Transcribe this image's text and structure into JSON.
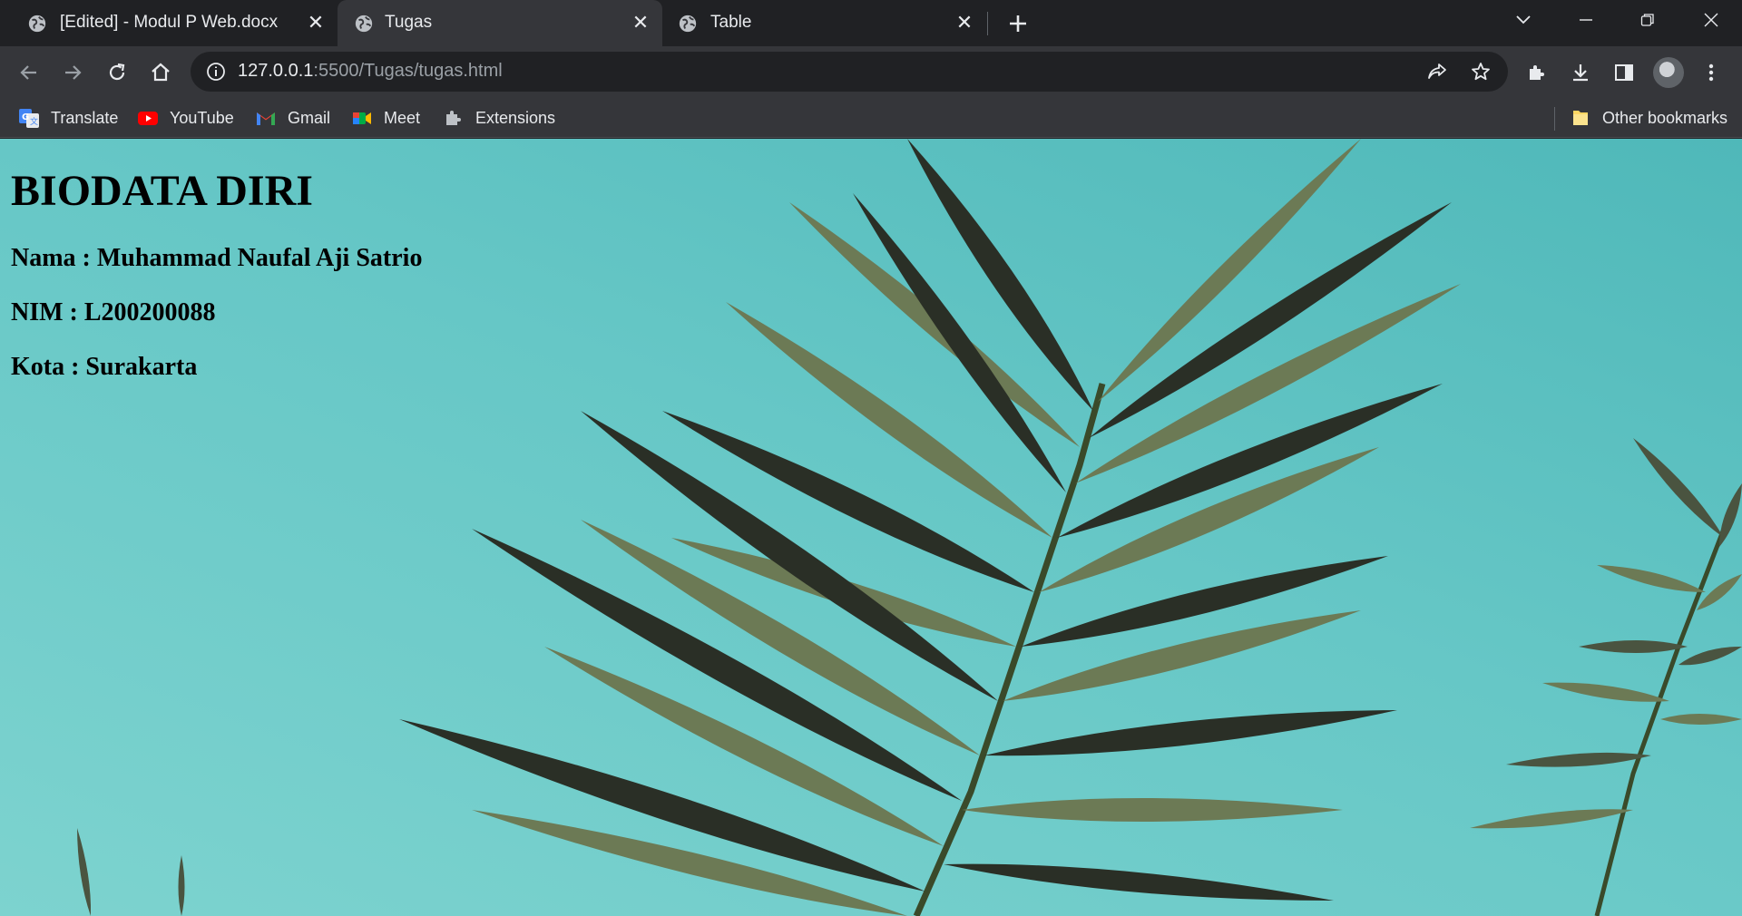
{
  "tabs": [
    {
      "title": "[Edited] - Modul P Web.docx",
      "active": false
    },
    {
      "title": "Tugas",
      "active": true
    },
    {
      "title": "Table",
      "active": false
    }
  ],
  "toolbar": {
    "url_host": "127.0.0.1",
    "url_rest": ":5500/Tugas/tugas.html"
  },
  "bookmarks": {
    "items": [
      {
        "label": "Translate",
        "icon": "google-translate-icon"
      },
      {
        "label": "YouTube",
        "icon": "youtube-icon"
      },
      {
        "label": "Gmail",
        "icon": "gmail-icon"
      },
      {
        "label": "Meet",
        "icon": "google-meet-icon"
      },
      {
        "label": "Extensions",
        "icon": "puzzle-icon"
      }
    ],
    "other": "Other bookmarks"
  },
  "page": {
    "heading": "BIODATA DIRI",
    "nama": "Nama : Muhammad Naufal Aji Satrio",
    "nim": "NIM : L200200088",
    "kota": "Kota : Surakarta"
  },
  "colors": {
    "chrome_dark": "#202124",
    "chrome_toolbar": "#35363a",
    "page_background": "#66c7c6"
  }
}
